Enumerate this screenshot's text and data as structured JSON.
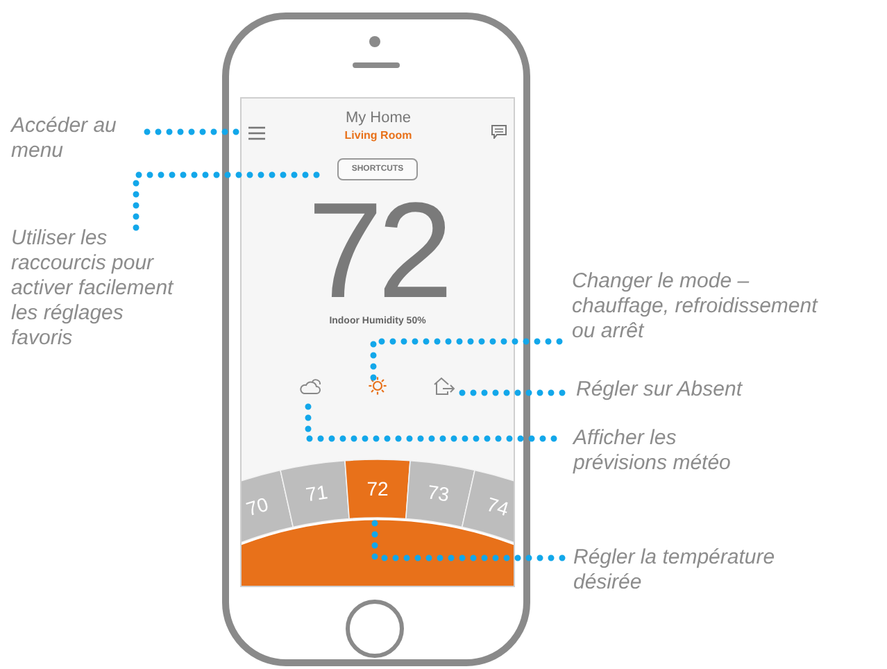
{
  "callouts": [
    {
      "text": "Accéder au menu"
    },
    {
      "text": "Utiliser les raccourcis pour activer facilement les réglages favoris"
    },
    {
      "text": "Changer le mode – chauffage, refroidissement ou arrêt"
    },
    {
      "text": "Régler sur Absent"
    },
    {
      "text": "Afficher les prévisions météo"
    },
    {
      "text": "Régler la température désirée"
    }
  ],
  "app": {
    "title": "My Home",
    "subtitle": "Living Room",
    "shortcuts_button": "SHORTCUTS",
    "temperature": "72",
    "humidity": "Indoor Humidity 50%",
    "icons": [
      {
        "kind": "weather",
        "selected": false
      },
      {
        "kind": "heat",
        "selected": true
      },
      {
        "kind": "away",
        "selected": false
      }
    ],
    "dial": [
      {
        "label": "70",
        "selected": false
      },
      {
        "label": "71",
        "selected": false
      },
      {
        "label": "72",
        "selected": true
      },
      {
        "label": "73",
        "selected": false
      },
      {
        "label": "74",
        "selected": false
      }
    ]
  }
}
